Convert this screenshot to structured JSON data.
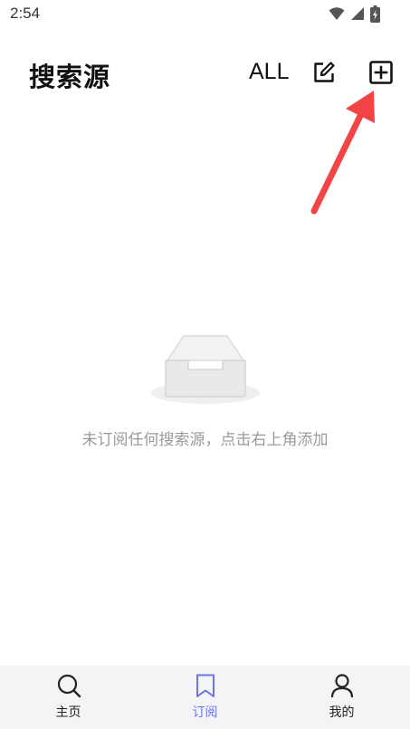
{
  "status_bar": {
    "time": "2:54",
    "icons": [
      "wifi-icon",
      "signal-icon",
      "battery-charging-icon"
    ]
  },
  "header": {
    "title": "搜索源",
    "all_label": "ALL",
    "edit_icon": "edit-icon",
    "add_icon": "add-square-icon"
  },
  "empty_state": {
    "icon": "empty-inbox-icon",
    "message": "未订阅任何搜索源，点击右上角添加"
  },
  "bottom_nav": {
    "items": [
      {
        "label": "主页",
        "icon": "search-icon",
        "active": false
      },
      {
        "label": "订阅",
        "icon": "bookmark-icon",
        "active": true
      },
      {
        "label": "我的",
        "icon": "user-icon",
        "active": false
      }
    ]
  },
  "colors": {
    "accent": "#6c74e8",
    "annotation_arrow": "#f24444",
    "muted_text": "#9a9a9a",
    "nav_background": "#f4f4f6"
  }
}
